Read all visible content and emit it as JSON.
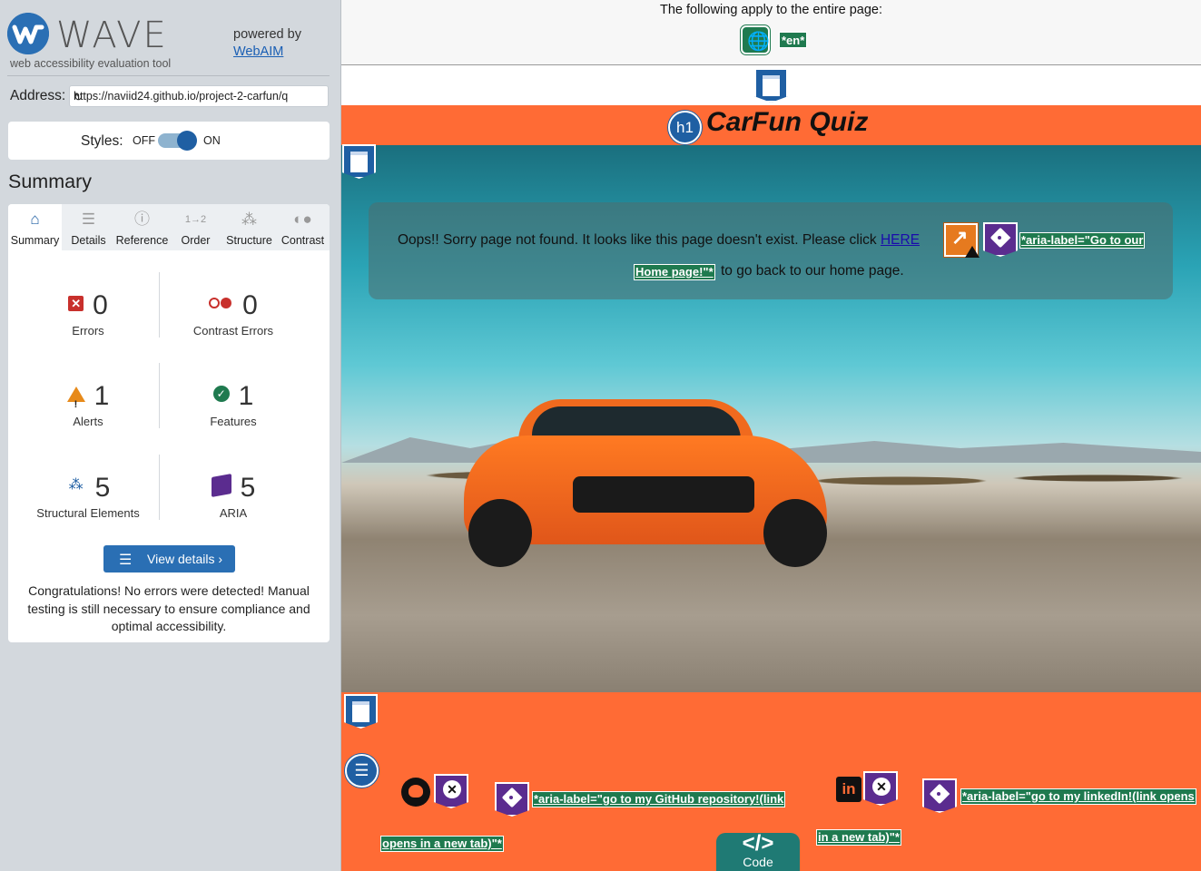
{
  "app": {
    "logo_text": "WAVE",
    "tagline": "web accessibility evaluation tool",
    "powered_by": "powered by",
    "powered_link": "WebAIM"
  },
  "address": {
    "label": "Address:",
    "value": "https://naviid24.github.io/project-2-carfun/q"
  },
  "styles": {
    "label": "Styles:",
    "off": "OFF",
    "on": "ON",
    "state": "on"
  },
  "summary": {
    "title": "Summary",
    "tabs": [
      {
        "label": "Summary",
        "icon": "home-icon"
      },
      {
        "label": "Details",
        "icon": "list-icon"
      },
      {
        "label": "Reference",
        "icon": "info-icon"
      },
      {
        "label": "Order",
        "icon": "order-icon"
      },
      {
        "label": "Structure",
        "icon": "structure-icon"
      },
      {
        "label": "Contrast",
        "icon": "contrast-icon"
      }
    ],
    "stats": [
      {
        "value": "0",
        "label": "Errors",
        "icon": "error-icon"
      },
      {
        "value": "0",
        "label": "Contrast Errors",
        "icon": "contrast-error-icon"
      },
      {
        "value": "1",
        "label": "Alerts",
        "icon": "alert-icon"
      },
      {
        "value": "1",
        "label": "Features",
        "icon": "feature-icon"
      },
      {
        "value": "5",
        "label": "Structural Elements",
        "icon": "structure-icon"
      },
      {
        "value": "5",
        "label": "ARIA",
        "icon": "aria-icon"
      }
    ],
    "view_details": "View details ›",
    "congrats": "Congratulations! No errors were detected! Manual testing is still necessary to ensure compliance and optimal accessibility."
  },
  "preview": {
    "entire_page_text": "The following apply to the entire page:",
    "lang_tag": "*en*",
    "site_title": "CarFun Quiz",
    "h1_badge": "h1",
    "notice_before_link": "Oops!! Sorry page not found. It looks like this page doesn't exist. Please click ",
    "notice_link": "HERE ",
    "notice_after": "to go back to our home page.",
    "aria_label_here_1": "*aria-label=\"Go to our",
    "aria_label_here_2": "Home page!\"*",
    "aria_label_github_1": "*aria-label=\"go to my GitHub repository!(link",
    "aria_label_github_2": "opens in a new tab)\"*",
    "aria_label_linkedin_1": "*aria-label=\"go to my linkedIn!(link opens",
    "aria_label_linkedin_2": "in a new tab)\"*",
    "code_glyph": "</>",
    "code_label": "Code"
  },
  "colors": {
    "brand_blue": "#1f5fa3",
    "error_red": "#c8302c",
    "feature_green": "#1f7a4f",
    "aria_purple": "#5b2c8f",
    "alert_orange": "#e67a1f",
    "site_orange": "#ff6b35"
  }
}
